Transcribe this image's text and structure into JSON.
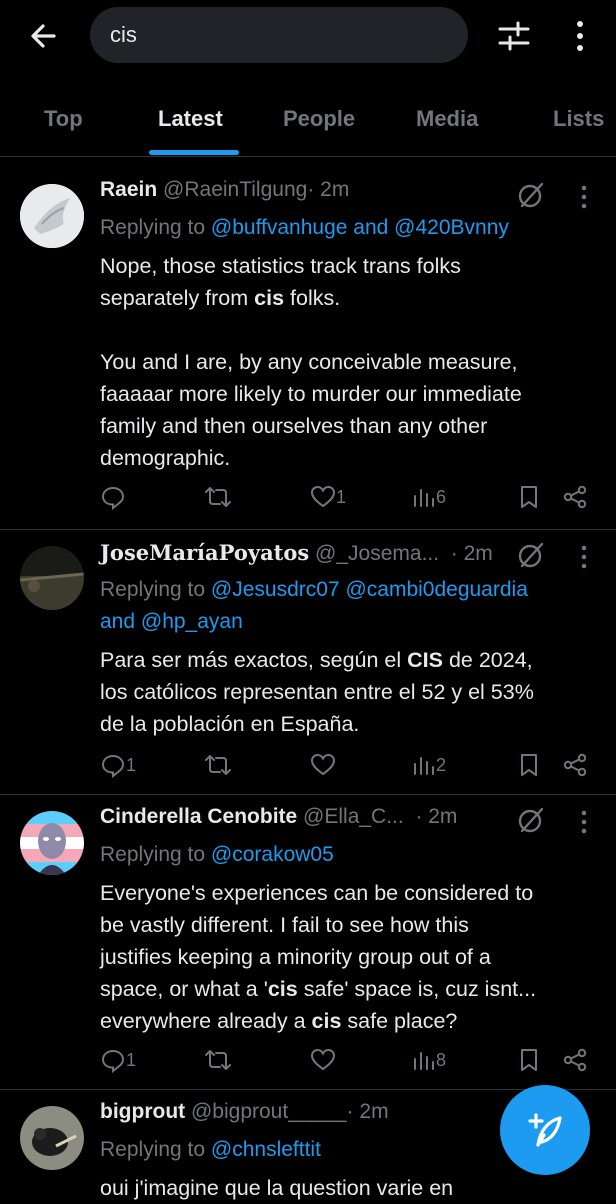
{
  "search": {
    "query": "cis"
  },
  "tabs": [
    "Top",
    "Latest",
    "People",
    "Media",
    "Lists"
  ],
  "active_tab": "Latest",
  "tweets": [
    {
      "name": "Raein",
      "handle": "@RaeinTilgung",
      "time": "· 2m",
      "replying_prefix": "Replying to ",
      "mentions": "@buffvanhuge and @420Bvnny",
      "body_lines": [
        [
          "Nope, those statistics track trans folks"
        ],
        [
          "separately from ",
          "cis",
          " folks."
        ],
        [
          ""
        ],
        [
          "You and I are, by any conceivable measure,"
        ],
        [
          "faaaaar more likely to murder our immediate"
        ],
        [
          "family and then ourselves than any other"
        ],
        [
          "demographic."
        ]
      ],
      "replies": "",
      "likes": "1",
      "views": "6"
    },
    {
      "name": "JoseMaríaPoyatos",
      "handle": "@_Josema...",
      "time": "· 2m",
      "replying_prefix": "Replying to ",
      "mentions_line1": "@Jesusdrc07 @cambi0deguardia",
      "mentions_line2": "and @hp_ayan",
      "body_lines": [
        [
          "Para ser más exactos, según el ",
          "CIS",
          " de 2024,"
        ],
        [
          "los católicos representan entre el 52 y el 53%"
        ],
        [
          "de la población en España."
        ]
      ],
      "replies": "1",
      "likes": "",
      "views": "2"
    },
    {
      "name": "Cinderella Cenobite",
      "handle": "@Ella_C...",
      "time": "· 2m",
      "replying_prefix": "Replying to ",
      "mentions": "@corakow05",
      "body_lines": [
        [
          "Everyone's experiences can be considered to"
        ],
        [
          "be vastly different. I fail to see how this"
        ],
        [
          "justifies keeping a minority group out of a"
        ],
        [
          "space, or what a '",
          "cis",
          " safe' space is, cuz isnt..."
        ],
        [
          "everywhere already a ",
          "cis",
          " safe place?"
        ]
      ],
      "replies": "1",
      "likes": "",
      "views": "8"
    },
    {
      "name": "bigprout",
      "handle": "@bigprout_____",
      "time": "· 2m",
      "replying_prefix": "Replying to ",
      "mentions": "@chnslefttit",
      "body_lines": [
        [
          "oui j'imagine que la question varie en"
        ]
      ]
    }
  ],
  "colors": {
    "accent": "#1d9bf0",
    "muted": "#71767b",
    "text": "#e7e9ea",
    "bg": "#000000"
  },
  "icons": [
    "back-arrow-icon",
    "filter-icon",
    "more-vertical-icon",
    "grok-icon",
    "reply-icon",
    "retweet-icon",
    "like-icon",
    "views-icon",
    "bookmark-icon",
    "share-icon",
    "compose-icon"
  ]
}
